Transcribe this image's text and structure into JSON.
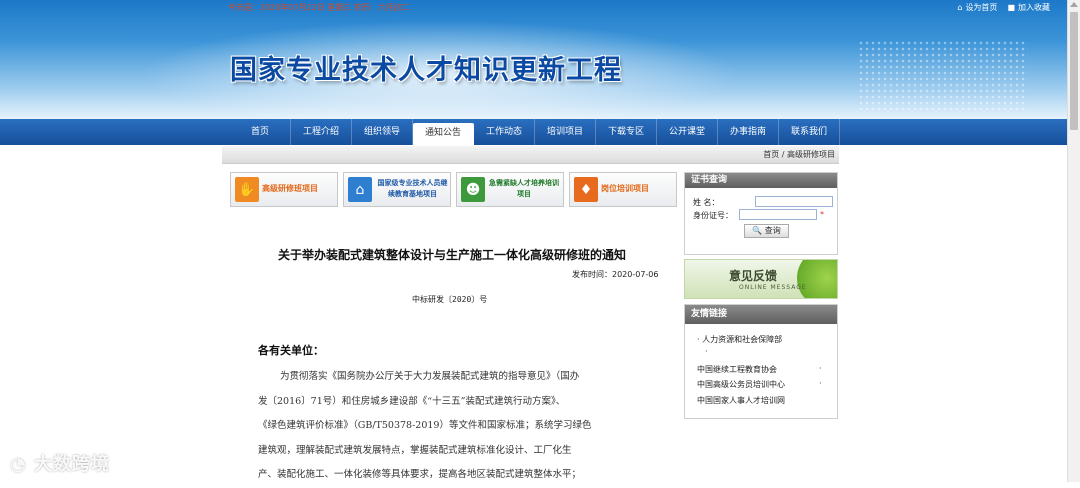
{
  "header": {
    "date_line": "今天是：2020年07月22日  星期三  农历：六月初二",
    "set_home": "设为首页",
    "add_fav": "加入收藏",
    "site_title": "国家专业技术人才知识更新工程"
  },
  "nav": {
    "tabs": [
      "首页",
      "工程介绍",
      "组织领导",
      "通知公告",
      "工作动态",
      "培训项目",
      "下载专区",
      "公开课堂",
      "办事指南",
      "联系我们"
    ],
    "active": "通知公告"
  },
  "breadcrumb": "首页 / 高级研修项目",
  "quick_links": [
    {
      "label": "高级研修班项目",
      "icon": "handshake-icon",
      "color": "#f08a22"
    },
    {
      "label": "国家级专业技术人员继续教育基地项目",
      "icon": "home-icon",
      "color": "#2f7fd0"
    },
    {
      "label": "急需紧缺人才培养培训项目",
      "icon": "people-icon",
      "color": "#3c9a3c"
    },
    {
      "label": "岗位培训项目",
      "icon": "tie-icon",
      "color": "#e86a1c"
    }
  ],
  "article": {
    "title": "关于举办装配式建筑整体设计与生产施工一体化高级研修班的通知",
    "publish_time": "发布时间：2020-07-06",
    "doc_number": "中标研发〔2020〕号",
    "greeting": "各有关单位：",
    "paragraph_lines": [
      "为贯彻落实《国务院办公厅关于大力发展装配式建筑的指导意见》（国办",
      "发〔2016〕71号）和住房城乡建设部《“十三五”装配式建筑行动方案》、",
      "《绿色建筑评价标准》（GB/T50378-2019）等文件和国家标准；系统学习绿色",
      "建筑观，理解装配式建筑发展特点，掌握装配式建筑标准化设计、工厂化生",
      "产、装配化施工、一体化装修等具体要求，提高各地区装配式建筑整体水平；"
    ]
  },
  "cert_query": {
    "title": "证书查询",
    "name_label": "姓        名：",
    "id_label": "身份证号：",
    "required_mark": "*",
    "button": "查询"
  },
  "feedback": {
    "title": "意见反馈",
    "subtitle": "ONLINE MESSAGE"
  },
  "friend_links": {
    "title": "友情链接",
    "items": [
      "人力资源和社会保障部",
      "中国继续工程教育协会",
      "中国高级公务员培训中心",
      "中国国家人事人才培训网"
    ]
  },
  "watermark": "大数跨境"
}
